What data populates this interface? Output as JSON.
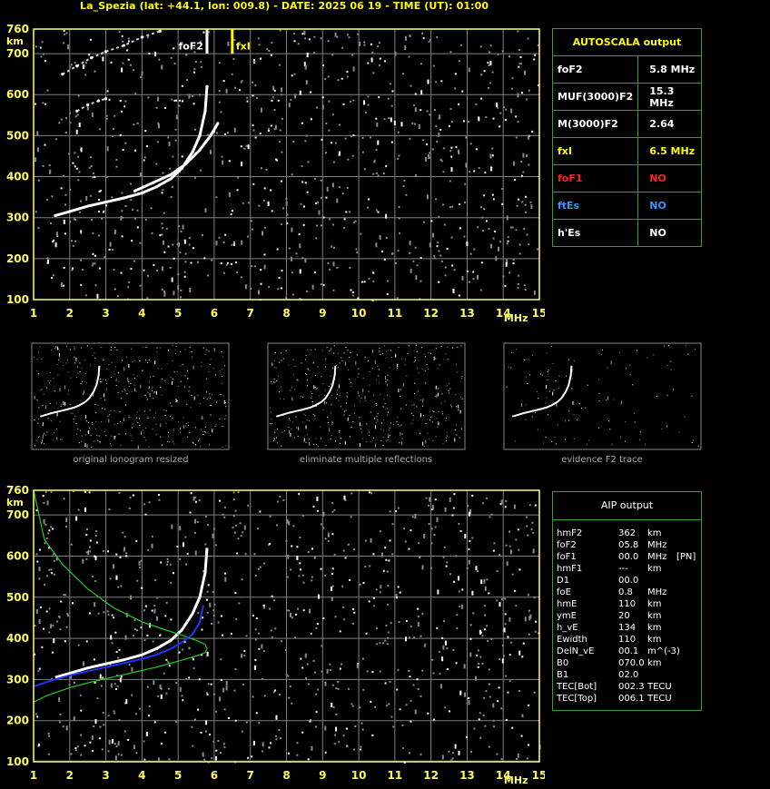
{
  "header": {
    "title": "La_Spezia (lat: +44.1, lon: 009.8) - DATE: 2025 06 19 - TIME (UT): 01:00"
  },
  "colors": {
    "axis": "#ffff66",
    "grid": "#808080",
    "trace": "#ffffff",
    "table_border": "#2e9e3e",
    "label_yellow": "#ffff00",
    "label_red": "#ff2020",
    "label_blue": "#3399ff",
    "profile_green": "#22cc22",
    "fit_blue": "#2233ff"
  },
  "autoscala": {
    "title": "AUTOSCALA output",
    "rows": [
      {
        "name": "foF2",
        "value": "5.8 MHz",
        "color": "#ffffff"
      },
      {
        "name": "MUF(3000)F2",
        "value": "15.3 MHz",
        "color": "#ffffff"
      },
      {
        "name": "M(3000)F2",
        "value": "2.64",
        "color": "#ffffff"
      },
      {
        "name": "fxI",
        "value": "6.5 MHz",
        "color": "#ffff00"
      },
      {
        "name": "foF1",
        "value": "NO",
        "color": "#ff2020"
      },
      {
        "name": "ftEs",
        "value": "NO",
        "color": "#3399ff"
      },
      {
        "name": "h'Es",
        "value": "NO",
        "color": "#ffffff"
      }
    ]
  },
  "aip": {
    "title": "AIP output",
    "rows": [
      {
        "name": "hmF2",
        "value": "362",
        "unit": "km",
        "extra": ""
      },
      {
        "name": "foF2",
        "value": "05.8",
        "unit": "MHz",
        "extra": ""
      },
      {
        "name": "foF1",
        "value": "00.0",
        "unit": "MHz",
        "extra": "[PN]"
      },
      {
        "name": "hmF1",
        "value": "---",
        "unit": "km",
        "extra": ""
      },
      {
        "name": "D1",
        "value": "00.0",
        "unit": "",
        "extra": ""
      },
      {
        "name": "foE",
        "value": "0.8",
        "unit": "MHz",
        "extra": ""
      },
      {
        "name": "hmE",
        "value": "110",
        "unit": "km",
        "extra": ""
      },
      {
        "name": "ymE",
        "value": "20",
        "unit": "km",
        "extra": ""
      },
      {
        "name": "h_vE",
        "value": "134",
        "unit": "km",
        "extra": ""
      },
      {
        "name": "Ewidth",
        "value": "110",
        "unit": "km",
        "extra": ""
      },
      {
        "name": "DelN_vE",
        "value": "00.1",
        "unit": "m^(-3)",
        "extra": ""
      },
      {
        "name": "B0",
        "value": "070.0",
        "unit": "km",
        "extra": ""
      },
      {
        "name": "B1",
        "value": "02.0",
        "unit": "",
        "extra": ""
      },
      {
        "name": "TEC[Bot]",
        "value": "002.3",
        "unit": "TECU",
        "extra": ""
      },
      {
        "name": "TEC[Top]",
        "value": "006.1",
        "unit": "TECU",
        "extra": ""
      }
    ]
  },
  "thumbnails": [
    {
      "caption": "original ionogram resized"
    },
    {
      "caption": "eliminate multiple reflections"
    },
    {
      "caption": "evidence F2 trace"
    }
  ],
  "chart_data": [
    {
      "type": "scatter",
      "xlim": [
        1,
        15
      ],
      "ylim": [
        100,
        760
      ],
      "xticks": [
        "1",
        "2",
        "3",
        "4",
        "5",
        "6",
        "7",
        "8",
        "9",
        "10",
        "11",
        "12",
        "13",
        "14",
        "15"
      ],
      "yticks": [
        "100",
        "200",
        "300",
        "400",
        "500",
        "600",
        "700",
        "760"
      ],
      "xunit": "MHz",
      "yunit": "km",
      "grid": true,
      "markers": [
        {
          "label": "foF2",
          "x": 5.8,
          "color": "#ffffff"
        },
        {
          "label": "fxI",
          "x": 6.5,
          "color": "#ffff00"
        }
      ],
      "series": [
        {
          "x": [
            1.6,
            2.0,
            2.5,
            3.0,
            3.5,
            4.0,
            4.4,
            4.8,
            5.1,
            5.4,
            5.6,
            5.75,
            5.8
          ],
          "y": [
            305,
            315,
            328,
            338,
            348,
            360,
            375,
            395,
            420,
            460,
            500,
            560,
            620
          ]
        },
        {
          "x": [
            3.8,
            4.3,
            4.8,
            5.2,
            5.6,
            5.9,
            6.1
          ],
          "y": [
            365,
            385,
            405,
            430,
            465,
            500,
            530
          ]
        },
        {
          "x": [
            2.2,
            2.5,
            2.8,
            3.0
          ],
          "y": [
            560,
            575,
            585,
            590
          ]
        },
        {
          "x": [
            1.8,
            2.2,
            2.6,
            3.0,
            3.5,
            4.0,
            4.5
          ],
          "y": [
            650,
            670,
            690,
            705,
            720,
            740,
            755
          ]
        }
      ]
    },
    {
      "type": "line",
      "xlim": [
        1,
        15
      ],
      "ylim": [
        100,
        760
      ],
      "xticks": [
        "1",
        "2",
        "3",
        "4",
        "5",
        "6",
        "7",
        "8",
        "9",
        "10",
        "11",
        "12",
        "13",
        "14",
        "15"
      ],
      "yticks": [
        "100",
        "200",
        "300",
        "400",
        "500",
        "600",
        "700",
        "760"
      ],
      "xunit": "MHz",
      "yunit": "km",
      "grid": true,
      "series": [
        {
          "x": [
            1.6,
            2.0,
            2.5,
            3.0,
            3.5,
            4.0,
            4.4,
            4.8,
            5.1,
            5.4,
            5.6,
            5.75,
            5.8
          ],
          "y": [
            305,
            315,
            328,
            338,
            348,
            360,
            375,
            395,
            420,
            460,
            500,
            560,
            620
          ]
        },
        {
          "x": [
            1.0,
            1.4,
            2.0,
            2.6,
            3.2,
            3.8,
            4.4,
            4.9,
            5.3,
            5.6,
            5.75,
            5.8,
            5.75,
            5.5,
            5.1,
            4.6,
            4.0,
            3.2,
            2.5,
            1.8,
            1.3,
            1.0
          ],
          "y": [
            245,
            262,
            280,
            294,
            306,
            318,
            330,
            342,
            352,
            360,
            366,
            375,
            385,
            395,
            408,
            422,
            440,
            475,
            520,
            580,
            640,
            760
          ]
        },
        {
          "x": [
            1.0,
            1.5,
            2.0,
            2.5,
            3.0,
            3.5,
            4.0,
            4.4,
            4.8,
            5.1,
            5.4,
            5.6,
            5.7
          ],
          "y": [
            283,
            298,
            310,
            320,
            330,
            340,
            350,
            360,
            375,
            390,
            410,
            440,
            480
          ]
        }
      ]
    }
  ]
}
